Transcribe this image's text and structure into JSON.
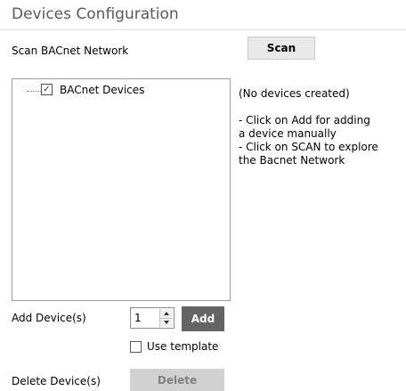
{
  "section": {
    "title": "Devices Configuration"
  },
  "scan": {
    "label": "Scan BACnet Network",
    "button_label": "Scan"
  },
  "tree": {
    "root_label": "BACnet Devices",
    "root_checked": true
  },
  "info": {
    "text": "(No devices created)\n\n- Click on Add for adding\n a device manually\n- Click on SCAN to explore\nthe Bacnet Network"
  },
  "add": {
    "label": "Add Device(s)",
    "count_value": "1",
    "button_label": "Add"
  },
  "template": {
    "label": "Use template",
    "checked": false
  },
  "delete": {
    "label": "Delete Device(s)",
    "button_label": "Delete",
    "enabled": false
  },
  "colors": {
    "add_button_bg": "#646464",
    "delete_button_bg": "#d1d1d1",
    "title_text": "#595959"
  }
}
